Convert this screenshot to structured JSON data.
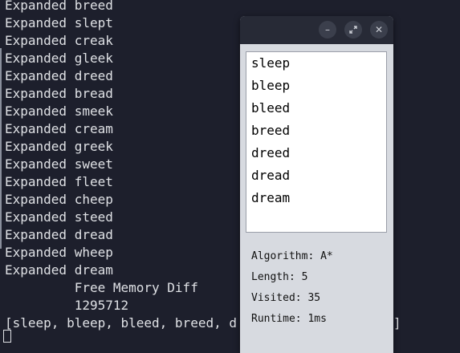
{
  "terminal": {
    "lines": [
      "Expanded breed",
      "Expanded slept",
      "Expanded creak",
      "Expanded gleek",
      "Expanded dreed",
      "Expanded bread",
      "Expanded smeek",
      "Expanded cream",
      "Expanded greek",
      "Expanded sweet",
      "Expanded fleet",
      "Expanded cheep",
      "Expanded steed",
      "Expanded dread",
      "Expanded wheep",
      "Expanded dream",
      "         Free Memory Diff",
      "         1295712",
      "[sleep, bleep, bleed, breed, d"
    ],
    "overflow_tail": "]"
  },
  "window": {
    "minimize_icon": "minimize-icon",
    "maximize_icon": "maximize-icon",
    "close_icon": "close-icon"
  },
  "path_list": [
    "sleep",
    "bleep",
    "bleed",
    "breed",
    "dreed",
    "dread",
    "dream"
  ],
  "stats": {
    "algorithm": "Algorithm: A*",
    "length": "Length: 5",
    "visited": "Visited: 35",
    "runtime": "Runtime: 1ms"
  }
}
